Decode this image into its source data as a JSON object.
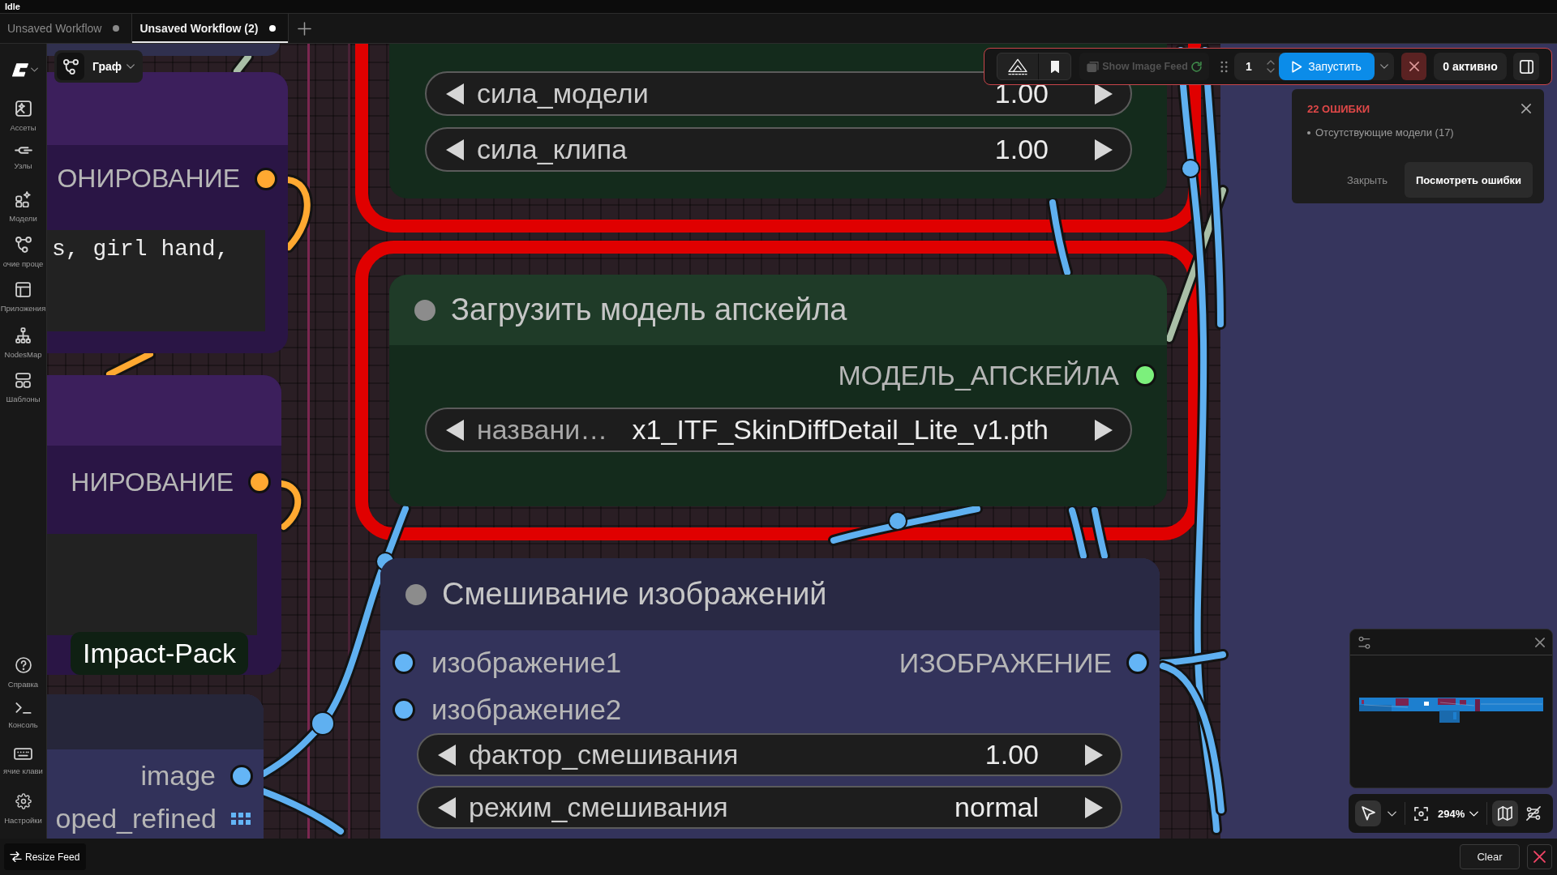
{
  "status": "Idle",
  "tabs": [
    {
      "label": "Unsaved Workflow",
      "selected": false,
      "unsaved": true
    },
    {
      "label": "Unsaved Workflow (2)",
      "selected": true,
      "unsaved": true
    }
  ],
  "sidebar": {
    "top_items": [
      {
        "label": "Ассеты"
      },
      {
        "label": "Узлы"
      },
      {
        "label": "Модели"
      },
      {
        "label": "очие проце"
      },
      {
        "label": "Приложения"
      },
      {
        "label": "NodesMap"
      },
      {
        "label": "Шаблоны"
      }
    ],
    "bottom_items": [
      {
        "label": "Справка"
      },
      {
        "label": "Консоль"
      },
      {
        "label": "ячие клави"
      },
      {
        "label": "Настройки"
      }
    ]
  },
  "view_menu": {
    "label": "Граф"
  },
  "groups": [
    {
      "color": "#36355d"
    }
  ],
  "nodes": [
    {
      "kind": "fragment",
      "color": "#30304e",
      "selected": false
    },
    {
      "kind": "prompt",
      "title_bar": {
        "color": "#3c1f5c"
      },
      "color": "#2a1545",
      "selected": false,
      "outputs": [
        {
          "label": "ОНИРОВАНИЕ",
          "color": "#ffa931"
        }
      ],
      "text": "s, girl hand,"
    },
    {
      "kind": "prompt",
      "title_bar": {
        "color": "#3c1f5c"
      },
      "color": "#2a1545",
      "selected": false,
      "outputs": [
        {
          "label": "НИРОВАНИЕ",
          "color": "#ffa931"
        }
      ]
    },
    {
      "kind": "outputs",
      "title_bar": {
        "color": "#26263a"
      },
      "color": "#32325a",
      "selected": false,
      "badge": "Impact-Pack",
      "outputs": [
        {
          "label": "image",
          "color": "#64b5f6",
          "kind": "dot"
        },
        {
          "label": "oped_refined",
          "color": "#64b5f6",
          "kind": "list"
        }
      ]
    },
    {
      "kind": "widgets",
      "color": "#142b1c",
      "selected": true,
      "widgets": [
        {
          "label": "сила_модели",
          "value": "1.00"
        },
        {
          "label": "сила_клипа",
          "value": "1.00"
        }
      ]
    },
    {
      "kind": "widgets",
      "title": "Загрузить модель апскейла",
      "title_bar": {
        "color": "#1f3b28"
      },
      "color": "#142b1c",
      "selected": true,
      "outputs": [
        {
          "label": "МОДЕЛЬ_АПСКЕЙЛА",
          "color": "#7cf07c"
        }
      ],
      "widgets": [
        {
          "label": "названи…",
          "value": "x1_ITF_SkinDiffDetail_Lite_v1.pth"
        }
      ]
    },
    {
      "kind": "widgets",
      "title": "Смешивание изображений",
      "title_bar": {
        "color": "#292944"
      },
      "color": "#33335b",
      "selected": false,
      "inputs": [
        {
          "label": "изображение1",
          "color": "#64b5f6"
        },
        {
          "label": "изображение2",
          "color": "#64b5f6"
        }
      ],
      "outputs": [
        {
          "label": "ИЗОБРАЖЕНИЕ",
          "color": "#64b5f6"
        }
      ],
      "widgets": [
        {
          "label": "фактор_смешивания",
          "value": "1.00"
        },
        {
          "label": "режим_смешивания",
          "value": "normal"
        }
      ]
    }
  ],
  "toolbar": {
    "image_feed": {
      "label": "Show Image Feed",
      "disabled": true
    },
    "queue_count": "1",
    "run_button": "Запустить",
    "active_count": "0 активно"
  },
  "errors_panel": {
    "title": "22 ОШИБКИ",
    "items": [
      "Отсутствующие модели (17)"
    ],
    "dismiss_button": "Закрыть",
    "view_button": "Посмотреть ошибки"
  },
  "canvas_controls": {
    "select_tool": {
      "selected": true
    },
    "zoom": "294%",
    "minimap_toggle": {
      "on": true
    }
  },
  "bottom_bar": {
    "resize_button": "Resize Feed",
    "clear_button": "Clear"
  }
}
